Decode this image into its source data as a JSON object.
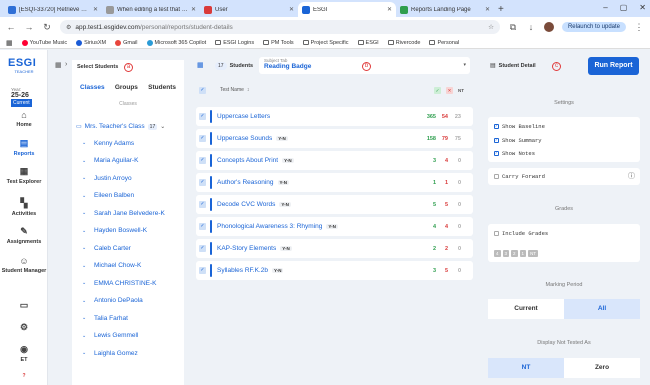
{
  "browser": {
    "tabs": [
      {
        "title": "[ESQI-33720] Retrieve Benchm...",
        "color": "#2f6fd6",
        "active": false
      },
      {
        "title": "When editing a test that has b...",
        "color": "#999999",
        "active": false
      },
      {
        "title": "User",
        "color": "#d93a3a",
        "active": false
      },
      {
        "title": "ESGI",
        "color": "#1a64d6",
        "active": true
      },
      {
        "title": "Reports Landing Page",
        "color": "#2e9e4e",
        "active": false
      }
    ],
    "new_tab": "+",
    "url_host": "app.test1.esgidev.com",
    "url_path": "/personal/reports/student-details",
    "relaunch_label": "Relaunch to update",
    "bookmarks": [
      "YouTube Music",
      "SiriusXM",
      "Gmail",
      "Microsoft 365 Copilot",
      "ESGI Logins",
      "PM Tools",
      "Project Specific",
      "ESGI",
      "Rivercode",
      "Personal"
    ]
  },
  "nav": {
    "logo": "ESGI",
    "logo_sub": "TEACHER",
    "year_label": "Year:",
    "year_value": "25-26",
    "year_status": "Current",
    "items": [
      {
        "label": "Home",
        "icon": "⌂"
      },
      {
        "label": "Reports",
        "icon": "▤"
      },
      {
        "label": "Test Explorer",
        "icon": "▦"
      },
      {
        "label": "Activities",
        "icon": "▚"
      },
      {
        "label": "Assignments",
        "icon": "✎"
      },
      {
        "label": "Student Manager",
        "icon": "☺"
      }
    ],
    "user_initials": "ET",
    "help": "?"
  },
  "students_panel": {
    "title": "Select Students",
    "tabs": [
      "Classes",
      "Groups",
      "Students"
    ],
    "section_label": "Classes",
    "class_name": "Mrs. Teacher's Class",
    "class_count": "17",
    "students": [
      "Kenny Adams",
      "Maria Aguilar-K",
      "Justin Arroyo",
      "Eileen Balben",
      "Sarah Jane Belvedere-K",
      "Hayden Boswell-K",
      "Caleb Carter",
      "Michael Chow-K",
      "EMMA CHRISTINE-K",
      "Antonio DePaola",
      "Talia Farhat",
      "Lewis Gemmell",
      "Laighla Gomez"
    ]
  },
  "main": {
    "students_count": "17",
    "students_label": "Students",
    "subject_label": "Subject Tab",
    "subject_value": "Reading Badge",
    "test_header": "Test Name",
    "header_nt": "NT",
    "tests": [
      {
        "name": "Uppercase Letters",
        "tag": "",
        "correct": "365",
        "incorrect": "54",
        "nt": "23"
      },
      {
        "name": "Uppercase Sounds",
        "tag": "Y-N",
        "correct": "158",
        "incorrect": "79",
        "nt": "75"
      },
      {
        "name": "Concepts About Print",
        "tag": "Y-N",
        "correct": "3",
        "incorrect": "4",
        "nt": "0"
      },
      {
        "name": "Author's Reasoning",
        "tag": "Y-N",
        "correct": "1",
        "incorrect": "1",
        "nt": "0"
      },
      {
        "name": "Decode CVC Words",
        "tag": "Y-N",
        "correct": "5",
        "incorrect": "5",
        "nt": "0"
      },
      {
        "name": "Phonological Awareness 3: Rhyming",
        "tag": "Y-N",
        "correct": "4",
        "incorrect": "4",
        "nt": "0"
      },
      {
        "name": "KAP-Story Elements",
        "tag": "Y-N",
        "correct": "2",
        "incorrect": "2",
        "nt": "0"
      },
      {
        "name": "Syllables RF.K.2b",
        "tag": "Y-N",
        "correct": "3",
        "incorrect": "5",
        "nt": "0"
      }
    ]
  },
  "settings": {
    "student_detail_label": "Student Detail",
    "run_report": "Run Report",
    "settings_header": "Settings",
    "show_baseline": "Show Baseline",
    "show_summary": "Show Summary",
    "show_notes": "Show Notes",
    "carry_forward": "Carry Forward",
    "grades_header": "Grades",
    "include_grades": "Include Grades",
    "grade_values": [
      "4",
      "3",
      "2",
      "1",
      "NT"
    ],
    "marking_header": "Marking Period",
    "marking_options": [
      "Current",
      "All"
    ],
    "display_header": "Display Not Tested As",
    "display_options": [
      "NT",
      "Zero"
    ]
  },
  "annotations": [
    "a",
    "b",
    "c"
  ]
}
